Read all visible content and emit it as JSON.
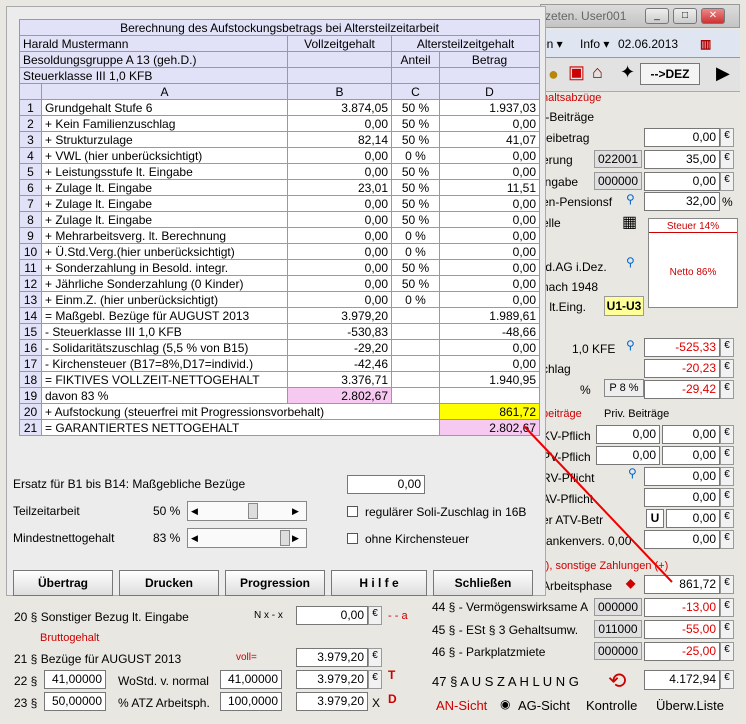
{
  "titlebar": {
    "text": "zeten.  User001",
    "btn_min": "_",
    "btn_max": "□",
    "btn_close": "✕"
  },
  "menubar": {
    "item_en": "en ▾",
    "item_info": "Info ▾",
    "date": "02.06.2013"
  },
  "toolbar": {
    "dez": "-->DEZ"
  },
  "right": {
    "section_title": "haltsabzüge",
    "row1_label": "/-Beiträge",
    "rows": [
      {
        "label": "reibetrag",
        "code": "",
        "value": "0,00"
      },
      {
        "label": "erung",
        "code": "022001",
        "value": "35,00"
      },
      {
        "label": "ingabe",
        "code": "000000",
        "value": "0,00"
      },
      {
        "label": "en-Pensionsf",
        "code": "",
        "value": "32,00",
        "unit": "%"
      }
    ],
    "elle": "elle",
    "tax_box": {
      "title": "Steuer 14%",
      "netto": "Netto  86%"
    },
    "dagdez": ".d.AG i.Dez.",
    "nach1948": "nach 1948",
    "eing": "z lt.Eing.",
    "u1u3": "U1-U3",
    "kfe": "1,0 KFE",
    "v1": "-525,33",
    "chlag": "chlag",
    "v2": "-20,23",
    "pct": "%",
    "p8": "P 8 %",
    "v3": "-29,42",
    "beitr_title": "beiträge",
    "priv_title": "Priv. Beiträge",
    "kv": "KV-Pflich",
    "pv": "PV-Pflich",
    "rv": "RV-Pflicht",
    "av": "AV-Pflicht",
    "atv": "er ATV-Betr",
    "kv2": "rankenvers. 0,00",
    "zero": "0,00",
    "u": "U",
    "zahl_title": "-), sonstige Zahlungen (+)",
    "arbeitsphase": "Arbeitsphase",
    "v_arb": "861,72",
    "r44": "44 § - Vermögenswirksame A",
    "c44": "000000",
    "v44": "-13,00",
    "r45": "45 § - ESt § 3 Gehaltsumw.",
    "c45": "011000",
    "v45": "-55,00",
    "r46": "46 § - Parkplatzmiete",
    "c46": "000000",
    "v46": "-25,00",
    "r47": "47 § A U S Z A H L U N G",
    "v47": "4.172,94",
    "euro": "€",
    "an": "AN-Sicht",
    "ag": "AG-Sicht",
    "kontrolle": "Kontrolle",
    "ueberw": "Überw.Liste"
  },
  "lower": {
    "r20": "20 § Sonstiger Bezug lt. Eingabe",
    "nx": "N x - x",
    "v20": "0,00",
    "aa": "- - a",
    "brutto": "Bruttogehalt",
    "r21": "21 §  Bezüge für AUGUST  2013",
    "voll": "voll=",
    "v21": "3.979,20",
    "n22": "22 §",
    "f22": "41,00000",
    "l22": "WoStd. v. normal",
    "g22": "41,00000",
    "v22": "3.979,20",
    "n23": "23 §",
    "f23": "50,00000",
    "l23": "% ATZ Arbeitsph.",
    "g23": "100,0000",
    "v23": "3.979,20",
    "x": "X",
    "euro": "€"
  },
  "dialog": {
    "title": "Berechnung des Aufstockungsbetrags bei Altersteilzeitarbeit",
    "name": "Harald Mustermann",
    "besold": "Besoldungsgruppe A 13 (geh.D.)",
    "steuer": "Steuerklasse III  1,0 KFB",
    "col_voll": "Vollzeitgehalt",
    "col_atz": "Altersteilzeitgehalt",
    "col_anteil": "Anteil",
    "col_betrag": "Betrag",
    "col_a": "A",
    "col_b": "B",
    "col_c": "C",
    "col_d": "D",
    "rows": [
      {
        "n": "1",
        "a": "Grundgehalt Stufe 6",
        "b": "3.874,05",
        "c": "50 %",
        "d": "1.937,03"
      },
      {
        "n": "2",
        "a": "  + Kein Familienzuschlag",
        "b": "0,00",
        "c": "50 %",
        "d": "0,00"
      },
      {
        "n": "3",
        "a": "  + Strukturzulage",
        "b": "82,14",
        "c": "50 %",
        "d": "41,07"
      },
      {
        "n": "4",
        "a": "  + VWL (hier unberücksichtigt)",
        "b": "0,00",
        "c": "0 %",
        "d": "0,00"
      },
      {
        "n": "5",
        "a": "  + Leistungsstufe lt. Eingabe",
        "b": "0,00",
        "c": "50 %",
        "d": "0,00"
      },
      {
        "n": "6",
        "a": "  + Zulage lt. Eingabe",
        "b": "23,01",
        "c": "50 %",
        "d": "11,51"
      },
      {
        "n": "7",
        "a": "  + Zulage lt. Eingabe",
        "b": "0,00",
        "c": "50 %",
        "d": "0,00"
      },
      {
        "n": "8",
        "a": "  + Zulage lt. Eingabe",
        "b": "0,00",
        "c": "50 %",
        "d": "0,00"
      },
      {
        "n": "9",
        "a": "  + Mehrarbeitsverg. lt. Berechnung",
        "b": "0,00",
        "c": "0 %",
        "d": "0,00"
      },
      {
        "n": "10",
        "a": "  + Ü.Std.Verg.(hier unberücksichtigt)",
        "b": "0,00",
        "c": "0 %",
        "d": "0,00"
      },
      {
        "n": "11",
        "a": "  + Sonderzahlung in Besold. integr.",
        "b": "0,00",
        "c": "50 %",
        "d": "0,00"
      },
      {
        "n": "12",
        "a": "  + Jährliche Sonderzahlung (0 Kinder)",
        "b": "0,00",
        "c": "50 %",
        "d": "0,00"
      },
      {
        "n": "13",
        "a": "  + Einm.Z. (hier unberücksichtigt)",
        "b": "0,00",
        "c": "0 %",
        "d": "0,00"
      },
      {
        "n": "14",
        "a": "= Maßgebl. Bezüge für AUGUST  2013",
        "b": "3.979,20",
        "c": "",
        "d": "1.989,61"
      },
      {
        "n": "15",
        "a": "-   Steuerklasse III  1,0 KFB",
        "b": "-530,83",
        "c": "",
        "d": "-48,66"
      },
      {
        "n": "16",
        "a": "-   Solidaritätszuschlag (5,5 % von B15)",
        "b": "-29,20",
        "c": "",
        "d": "0,00"
      },
      {
        "n": "17",
        "a": "-   Kirchensteuer (B17=8%,D17=individ.)",
        "b": "-42,46",
        "c": "",
        "d": "0,00"
      },
      {
        "n": "18",
        "a": "= FIKTIVES VOLLZEIT-NETTOGEHALT",
        "b": "3.376,71",
        "c": "",
        "d": "1.940,95"
      }
    ],
    "r19_n": "19",
    "r19_a": "  davon 83 %",
    "r19_b": "2.802,67",
    "r20_n": "20",
    "r20_a": "+ Aufstockung (steuerfrei mit Progressionsvorbehalt)",
    "r20_d": "861,72",
    "r21_n": "21",
    "r21_a": "= GARANTIERTES NETTOGEHALT",
    "r21_d": "2.802,67",
    "ersatz_label": "Ersatz für B1 bis B14: Maßgebliche Bezüge",
    "ersatz_value": "0,00",
    "teilzeit_label": "Teilzeitarbeit",
    "teilzeit_pct": "50 %",
    "mindest_label": "Mindestnettogehalt",
    "mindest_pct": "83 %",
    "soli_label": "regulärer Soli-Zuschlag in 16B",
    "kirche_label": "ohne Kirchensteuer",
    "buttons": {
      "uebertrag": "Übertrag",
      "drucken": "Drucken",
      "progression": "Progression",
      "hilfe": "H i l f e",
      "schliessen": "Schließen"
    }
  }
}
